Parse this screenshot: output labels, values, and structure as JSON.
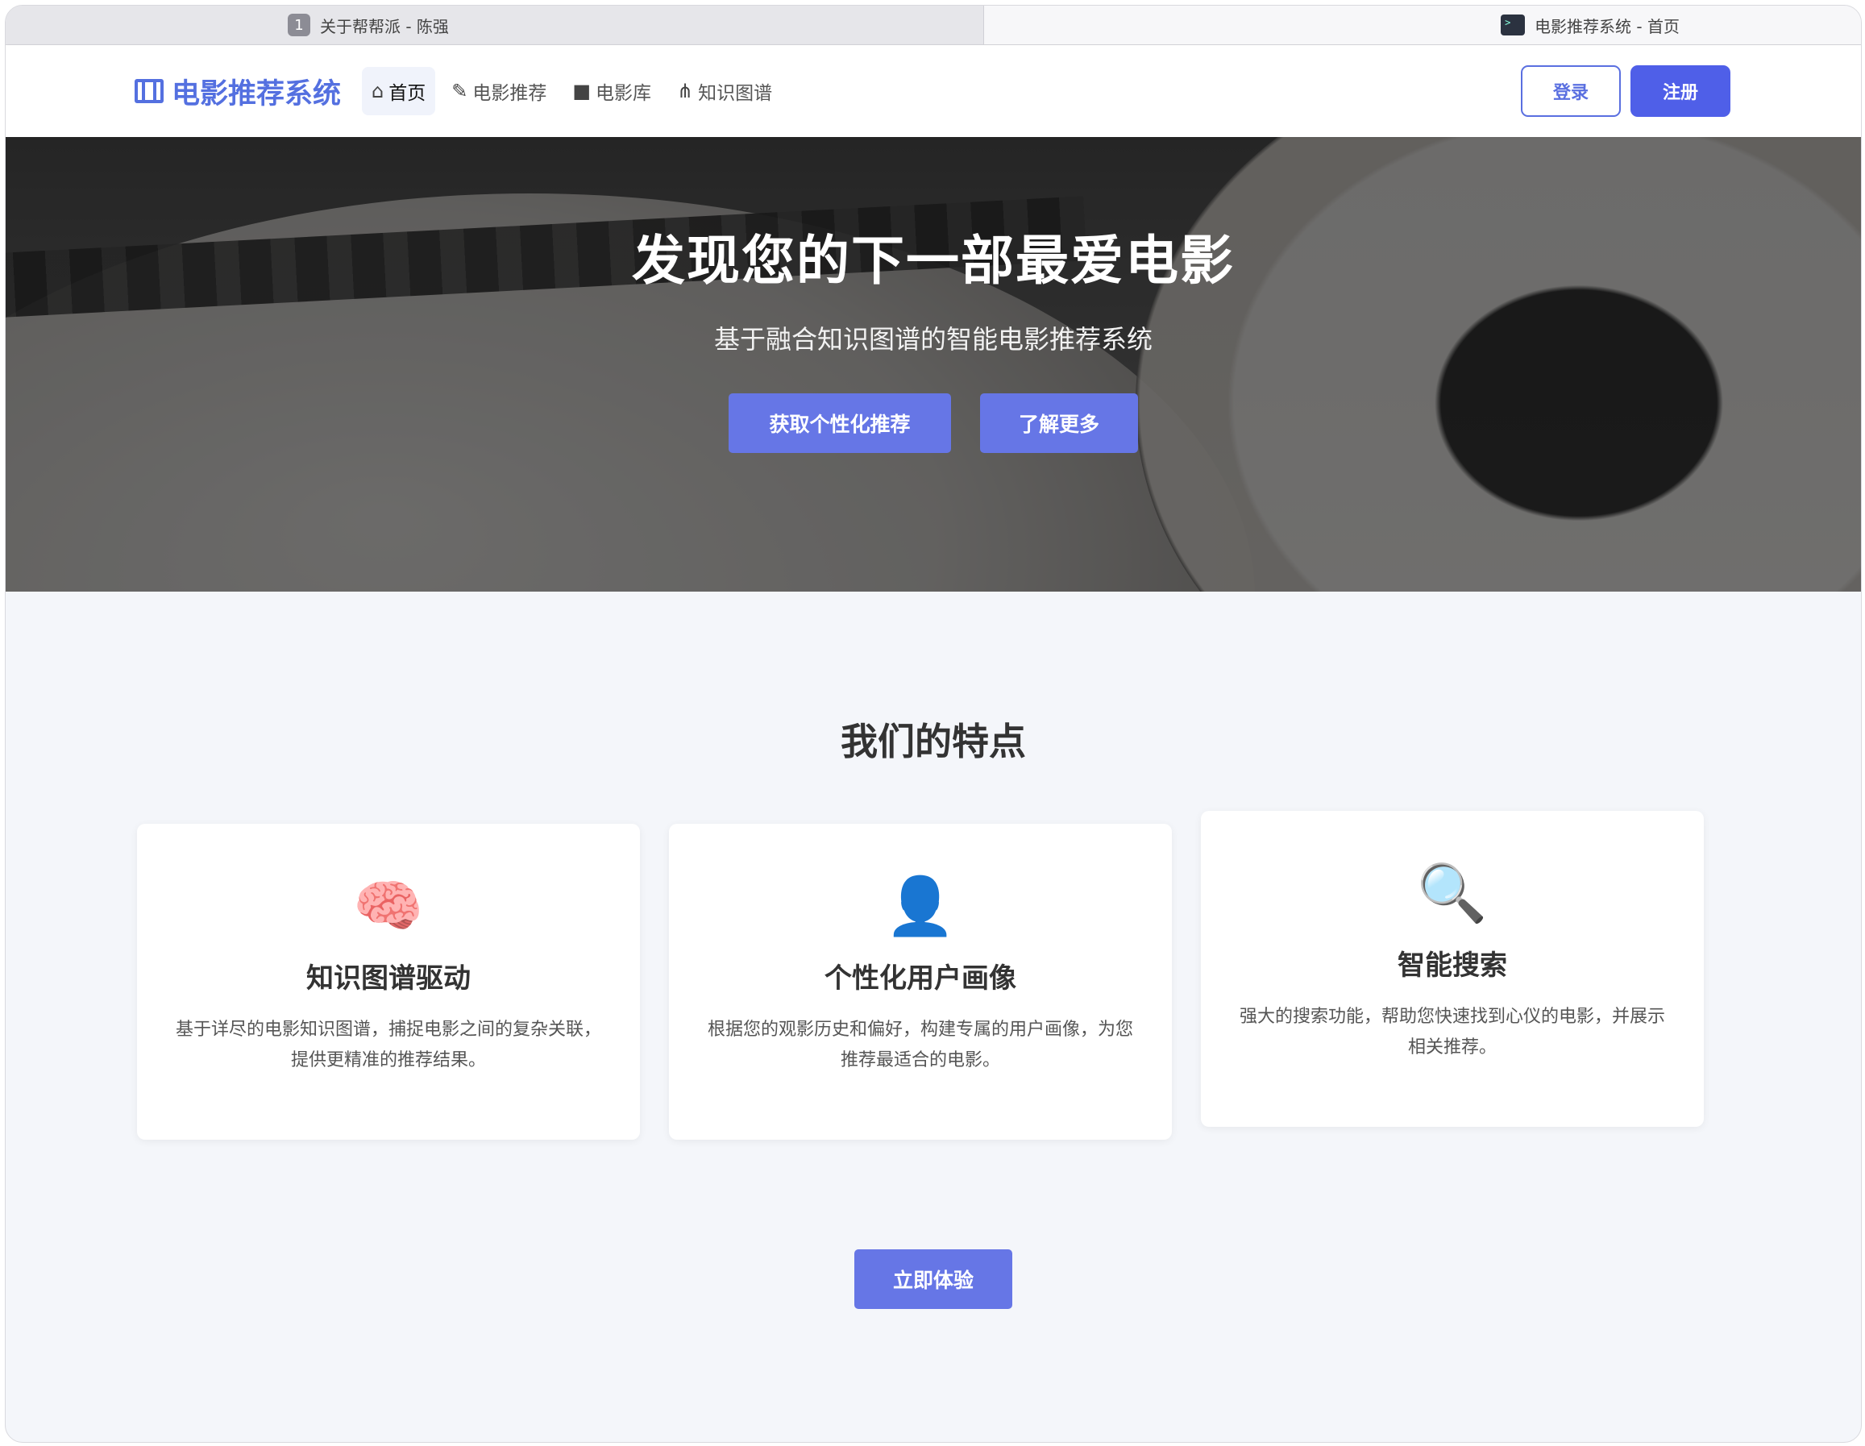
{
  "tabs": [
    {
      "badge": "1",
      "title": "关于帮帮派 - 陈强"
    },
    {
      "title": "电影推荐系统 - 首页"
    }
  ],
  "navbar": {
    "brand": "电影推荐系统",
    "items": [
      {
        "label": "首页",
        "icon": "home-icon"
      },
      {
        "label": "电影推荐",
        "icon": "pencil-icon"
      },
      {
        "label": "电影库",
        "icon": "video-camera-icon"
      },
      {
        "label": "知识图谱",
        "icon": "graph-icon"
      }
    ],
    "login": "登录",
    "register": "注册"
  },
  "hero": {
    "title": "发现您的下一部最爱电影",
    "subtitle": "基于融合知识图谱的智能电影推荐系统",
    "primary_button": "获取个性化推荐",
    "secondary_button": "了解更多"
  },
  "features": {
    "title": "我们的特点",
    "cards": [
      {
        "icon": "🧠",
        "title": "知识图谱驱动",
        "desc": "基于详尽的电影知识图谱，捕捉电影之间的复杂关联，提供更精准的推荐结果。"
      },
      {
        "icon": "👤",
        "title": "个性化用户画像",
        "desc": "根据您的观影历史和偏好，构建专属的用户画像，为您推荐最适合的电影。"
      },
      {
        "icon": "🔍",
        "title": "智能搜索",
        "desc": "强大的搜索功能，帮助您快速找到心仪的电影，并展示相关推荐。"
      }
    ],
    "cta": "立即体验"
  },
  "colors": {
    "accent": "#4f5fe8",
    "hero_button": "#6676e6",
    "brand": "#5470e0"
  }
}
